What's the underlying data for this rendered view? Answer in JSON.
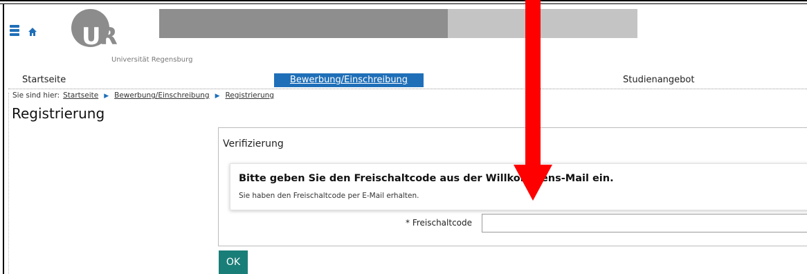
{
  "header": {
    "logo_text": "UR",
    "university_name": "Universität Regensburg"
  },
  "nav": {
    "items": [
      {
        "label": "Startseite"
      },
      {
        "label": "Bewerbung/Einschreibung",
        "active": true
      },
      {
        "label": "Studienangebot"
      }
    ]
  },
  "breadcrumb": {
    "lead": "Sie sind hier:",
    "items": [
      "Startseite",
      "Bewerbung/Einschreibung",
      "Registrierung"
    ]
  },
  "page": {
    "title": "Registrierung"
  },
  "verification": {
    "panel_title": "Verifizierung",
    "heading": "Bitte geben Sie den Freischaltcode aus der Willkommens-Mail ein.",
    "subtext": "Sie haben den Freischaltcode per E-Mail erhalten.",
    "field_label": "* Freischaltcode",
    "field_value": ""
  },
  "actions": {
    "ok_label": "OK"
  },
  "colors": {
    "primary": "#1f6fb8",
    "button": "#1a7e78",
    "annotation_arrow": "#ff0000"
  },
  "icons": [
    "menu-icon",
    "home-icon",
    "chevron-right-icon"
  ]
}
